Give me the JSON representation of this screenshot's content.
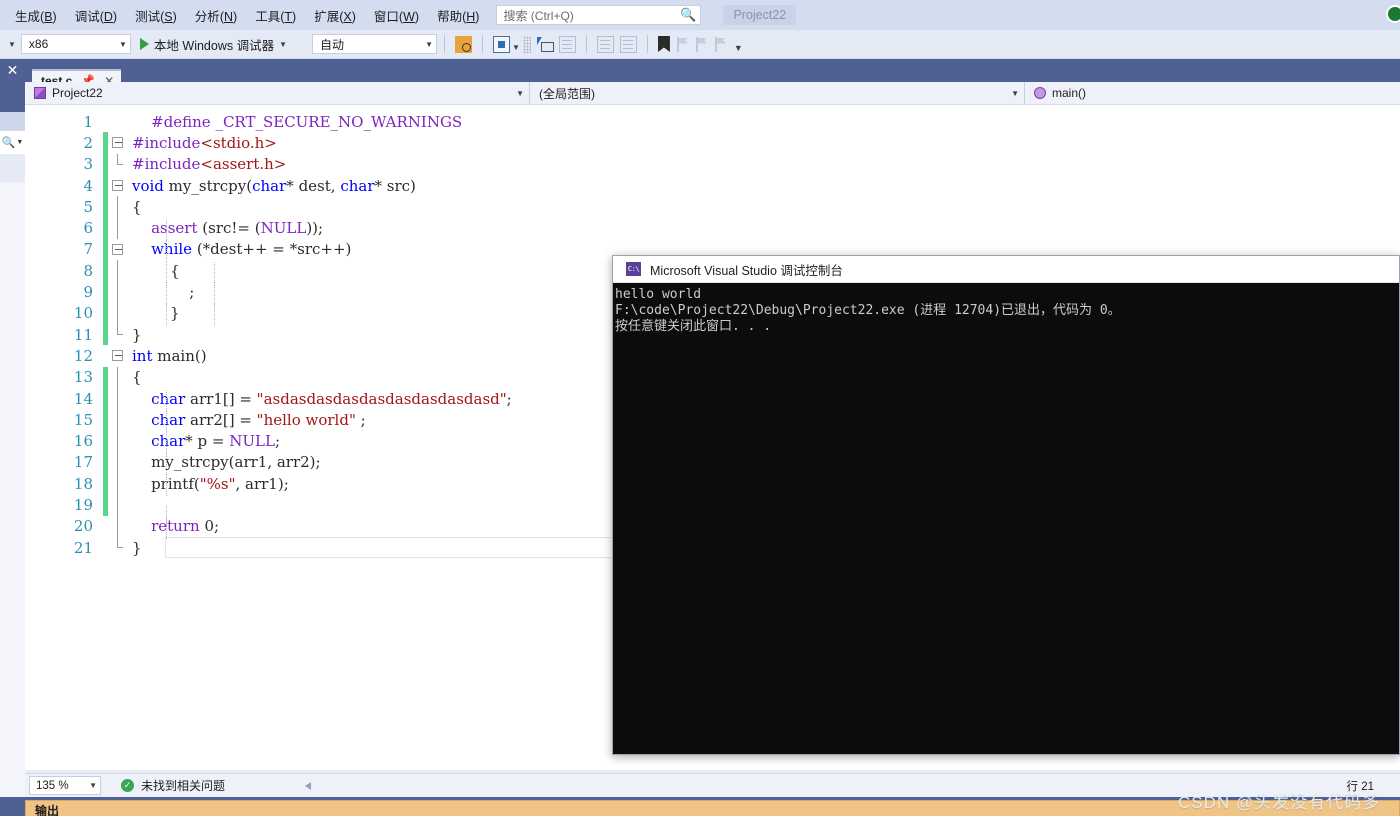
{
  "menubar": {
    "items": [
      {
        "text": "生成",
        "key": "B"
      },
      {
        "text": "调试",
        "key": "D"
      },
      {
        "text": "测试",
        "key": "S"
      },
      {
        "text": "分析",
        "key": "N"
      },
      {
        "text": "工具",
        "key": "T"
      },
      {
        "text": "扩展",
        "key": "X"
      },
      {
        "text": "窗口",
        "key": "W"
      },
      {
        "text": "帮助",
        "key": "H"
      }
    ],
    "search_placeholder": "搜索 (Ctrl+Q)",
    "search_icon": "search-icon",
    "solution_title": "Project22"
  },
  "toolbar": {
    "platform": "x86",
    "run_label": "本地 Windows 调试器",
    "config": "自动",
    "icons": [
      "find-in-files-icon",
      "solution-explorer-icon",
      "properties-window-icon",
      "toolbox-icon",
      "comment-icon",
      "uncomment-icon",
      "indent-icon",
      "outdent-icon",
      "bookmark-icon",
      "previous-bookmark-icon",
      "next-bookmark-icon",
      "clear-bookmarks-icon"
    ]
  },
  "tabs": {
    "active": "test.c",
    "pin_icon": "pin-icon",
    "close_icon": "close-icon"
  },
  "navbar": {
    "project": "Project22",
    "scope": "(全局范围)",
    "member": "main()"
  },
  "editor": {
    "lines": [
      {
        "n": 1,
        "changed": false,
        "fold": "none",
        "guides": [],
        "tokens": [
          {
            "t": "    ",
            "c": "id"
          },
          {
            "t": "#define",
            "c": "pp"
          },
          {
            "t": " ",
            "c": "id"
          },
          {
            "t": "_CRT_SECURE_NO_WARNINGS",
            "c": "kw2"
          }
        ]
      },
      {
        "n": 2,
        "changed": true,
        "fold": "open",
        "guides": [],
        "tokens": [
          {
            "t": "#include",
            "c": "pp"
          },
          {
            "t": "<stdio.h>",
            "c": "inc"
          }
        ]
      },
      {
        "n": 3,
        "changed": true,
        "fold": "endv",
        "guides": [],
        "tokens": [
          {
            "t": "#include",
            "c": "pp"
          },
          {
            "t": "<assert.h>",
            "c": "inc"
          }
        ]
      },
      {
        "n": 4,
        "changed": true,
        "fold": "open",
        "guides": [],
        "tokens": [
          {
            "t": "void",
            "c": "kw"
          },
          {
            "t": " my_strcpy(",
            "c": "id"
          },
          {
            "t": "char",
            "c": "kw"
          },
          {
            "t": "* dest, ",
            "c": "id"
          },
          {
            "t": "char",
            "c": "kw"
          },
          {
            "t": "* src)",
            "c": "id"
          }
        ]
      },
      {
        "n": 5,
        "changed": true,
        "fold": "line",
        "guides": [],
        "tokens": [
          {
            "t": "{",
            "c": "id"
          }
        ]
      },
      {
        "n": 6,
        "changed": true,
        "fold": "line",
        "guides": [
          36
        ],
        "tokens": [
          {
            "t": "    ",
            "c": "id"
          },
          {
            "t": "assert",
            "c": "kw2"
          },
          {
            "t": " (src!= (",
            "c": "id"
          },
          {
            "t": "NULL",
            "c": "kw2"
          },
          {
            "t": "));",
            "c": "id"
          }
        ]
      },
      {
        "n": 7,
        "changed": true,
        "fold": "open2",
        "guides": [
          36
        ],
        "tokens": [
          {
            "t": "    ",
            "c": "id"
          },
          {
            "t": "while",
            "c": "kw"
          },
          {
            "t": " (*dest++ = *src++)",
            "c": "id"
          }
        ]
      },
      {
        "n": 8,
        "changed": true,
        "fold": "line",
        "guides": [
          36,
          84
        ],
        "tokens": [
          {
            "t": "        {",
            "c": "id"
          }
        ]
      },
      {
        "n": 9,
        "changed": true,
        "fold": "line",
        "guides": [
          36,
          84
        ],
        "tokens": [
          {
            "t": "            ;",
            "c": "id"
          }
        ]
      },
      {
        "n": 10,
        "changed": true,
        "fold": "line",
        "guides": [
          36,
          84
        ],
        "tokens": [
          {
            "t": "        }",
            "c": "id"
          }
        ]
      },
      {
        "n": 11,
        "changed": true,
        "fold": "endb",
        "guides": [],
        "tokens": [
          {
            "t": "}",
            "c": "id"
          }
        ]
      },
      {
        "n": 12,
        "changed": false,
        "fold": "open",
        "guides": [],
        "tokens": [
          {
            "t": "int",
            "c": "kw"
          },
          {
            "t": " main()",
            "c": "id"
          }
        ]
      },
      {
        "n": 13,
        "changed": true,
        "fold": "line",
        "guides": [],
        "tokens": [
          {
            "t": "{",
            "c": "id"
          }
        ]
      },
      {
        "n": 14,
        "changed": true,
        "fold": "line",
        "guides": [
          36
        ],
        "tokens": [
          {
            "t": "    ",
            "c": "id"
          },
          {
            "t": "char",
            "c": "kw"
          },
          {
            "t": " arr1[] = ",
            "c": "id"
          },
          {
            "t": "\"asdasdasdasdasdasdasdasdasd\"",
            "c": "str"
          },
          {
            "t": ";",
            "c": "id"
          }
        ]
      },
      {
        "n": 15,
        "changed": true,
        "fold": "line",
        "guides": [
          36
        ],
        "tokens": [
          {
            "t": "    ",
            "c": "id"
          },
          {
            "t": "char",
            "c": "kw"
          },
          {
            "t": " arr2[] = ",
            "c": "id"
          },
          {
            "t": "\"hello world\"",
            "c": "str"
          },
          {
            "t": " ;",
            "c": "id"
          }
        ]
      },
      {
        "n": 16,
        "changed": true,
        "fold": "line",
        "guides": [
          36
        ],
        "tokens": [
          {
            "t": "    ",
            "c": "id"
          },
          {
            "t": "char",
            "c": "kw"
          },
          {
            "t": "* p = ",
            "c": "id"
          },
          {
            "t": "NULL",
            "c": "kw2"
          },
          {
            "t": ";",
            "c": "id"
          }
        ]
      },
      {
        "n": 17,
        "changed": true,
        "fold": "line",
        "guides": [
          36
        ],
        "tokens": [
          {
            "t": "    my_strcpy(arr1, arr2);",
            "c": "id"
          }
        ]
      },
      {
        "n": 18,
        "changed": true,
        "fold": "line",
        "guides": [
          36
        ],
        "tokens": [
          {
            "t": "    printf(",
            "c": "id"
          },
          {
            "t": "\"%s\"",
            "c": "str"
          },
          {
            "t": ", arr1);",
            "c": "id"
          }
        ]
      },
      {
        "n": 19,
        "changed": true,
        "fold": "line",
        "guides": [
          36
        ],
        "tokens": [
          {
            "t": "",
            "c": "id"
          }
        ]
      },
      {
        "n": 20,
        "changed": false,
        "fold": "line",
        "guides": [
          36
        ],
        "tokens": [
          {
            "t": "    ",
            "c": "id"
          },
          {
            "t": "return",
            "c": "kw2"
          },
          {
            "t": " ",
            "c": "id"
          },
          {
            "t": "0",
            "c": "num"
          },
          {
            "t": ";",
            "c": "id"
          }
        ]
      },
      {
        "n": 21,
        "changed": false,
        "fold": "endb",
        "guides": [],
        "current": true,
        "tokens": [
          {
            "t": "}",
            "c": "id"
          }
        ]
      }
    ]
  },
  "console": {
    "title": "Microsoft Visual Studio 调试控制台",
    "icon": "console-icon",
    "output": "hello world\nF:\\code\\Project22\\Debug\\Project22.exe (进程 12704)已退出，代码为 0。\n按任意键关闭此窗口. . ."
  },
  "statusbar": {
    "zoom": "135 %",
    "problems": "未找到相关问题",
    "ok_icon": "check-circle-icon",
    "line_label": "行",
    "line_number": "21"
  },
  "bottom_panel": {
    "title": "输出"
  },
  "watermark": "CSDN @头发没有代码多",
  "colors": {
    "menu_bg": "#d4dcef",
    "toolbar_bg": "#e3e9f5",
    "frame_blue": "#4f6193",
    "editor_bg": "#ffffff",
    "line_number": "#2b91af",
    "keyword": "#0000ff",
    "keyword2": "#7b25c1",
    "string": "#a31515",
    "changebar_green": "#58d68d",
    "console_bg": "#0c0c0c",
    "output_panel": "#f0c485"
  }
}
